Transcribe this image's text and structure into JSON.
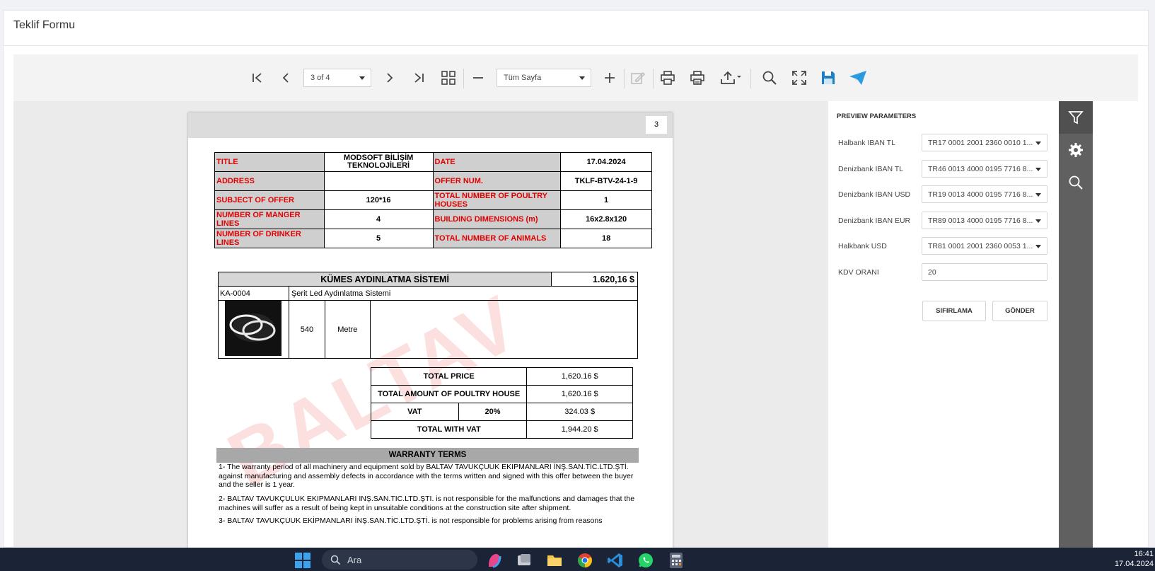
{
  "app": {
    "title": "Teklif Formu"
  },
  "toolbar": {
    "page_select": "3 of 4",
    "zoom_select": "Tüm Sayfa"
  },
  "document": {
    "page_number": "3",
    "info_rows": [
      {
        "l1": "TITLE",
        "v1": "MODSOFT BİLİŞİM TEKNOLOJİLERİ",
        "l2": "DATE",
        "v2": "17.04.2024"
      },
      {
        "l1": "ADDRESS",
        "v1": "",
        "l2": "OFFER NUM.",
        "v2": "TKLF-BTV-24-1-9"
      },
      {
        "l1": "SUBJECT OF OFFER",
        "v1": "120*16",
        "l2": "TOTAL NUMBER OF POULTRY HOUSES",
        "v2": "1"
      },
      {
        "l1": "NUMBER OF MANGER LINES",
        "v1": "4",
        "l2": "BUILDING DIMENSIONS (m)",
        "v2": "16x2.8x120"
      },
      {
        "l1": "NUMBER OF DRINKER LINES",
        "v1": "5",
        "l2": "TOTAL NUMBER OF ANIMALS",
        "v2": "18"
      }
    ],
    "product": {
      "section_title": "KÜMES AYDINLATMA SİSTEMİ",
      "section_price": "1.620,16 $",
      "code": "KA-0004",
      "name": "Şerit Led Aydınlatma Sistemi",
      "quantity": "540",
      "unit": "Metre"
    },
    "totals": {
      "total_price_label": "TOTAL PRICE",
      "total_price": "1,620.16 $",
      "total_house_label": "TOTAL AMOUNT OF POULTRY HOUSE",
      "total_house": "1,620.16 $",
      "vat_label": "VAT",
      "vat_rate": "20%",
      "vat_amount": "324.03 $",
      "with_vat_label": "TOTAL WITH VAT",
      "with_vat": "1,944.20 $"
    },
    "warranty": {
      "title": "WARRANTY TERMS",
      "t1": "1- The warranty period of all machinery and equipment sold by BALTAV TAVUKÇUUK EKIPMANLARI İNŞ.SAN.TİC.LTD.ŞTİ. against manufacturing and assembly defects in accordance with the terms written and signed with this offer between the buyer and the seller is 1 year.",
      "t2": "2- BALTAV TAVUKÇULUK EKIPMANLARI INŞ.SAN.TIC.LTD.ŞTI. is not responsible for the malfunctions and damages that the machines will suffer as a result of being kept in unsuitable conditions at the construction site after shipment.",
      "t3": "3- BALTAV TAVUKÇUUK EKİPMANLARI İNŞ.SAN.TİC.LTD.ŞTİ. is not responsible for problems arising from reasons"
    },
    "watermark": "BALTAV"
  },
  "side_panel": {
    "title": "PREVIEW PARAMETERS",
    "params": [
      {
        "label": "Halbank IBAN TL",
        "value": "TR17 0001 2001 2360 0010 1..."
      },
      {
        "label": "Denizbank IBAN TL",
        "value": "TR46 0013 4000 0195 7716 8..."
      },
      {
        "label": "Denizbank IBAN USD",
        "value": "TR19 0013 4000 0195 7716 8..."
      },
      {
        "label": "Denizbank IBAN EUR",
        "value": "TR89 0013 4000 0195 7716 8..."
      },
      {
        "label": "Halkbank USD",
        "value": "TR81 0001 2001 2360 0053 1..."
      }
    ],
    "kdv_label": "KDV ORANI",
    "kdv_value": "20",
    "reset_label": "SIFIRLAMA",
    "submit_label": "GÖNDER"
  },
  "taskbar": {
    "search_placeholder": "Ara",
    "time": "16:41",
    "date": "17.04.2024"
  },
  "colors": {
    "accent": "#1f7fc4",
    "red": "#e00000",
    "rail": "#606060"
  }
}
